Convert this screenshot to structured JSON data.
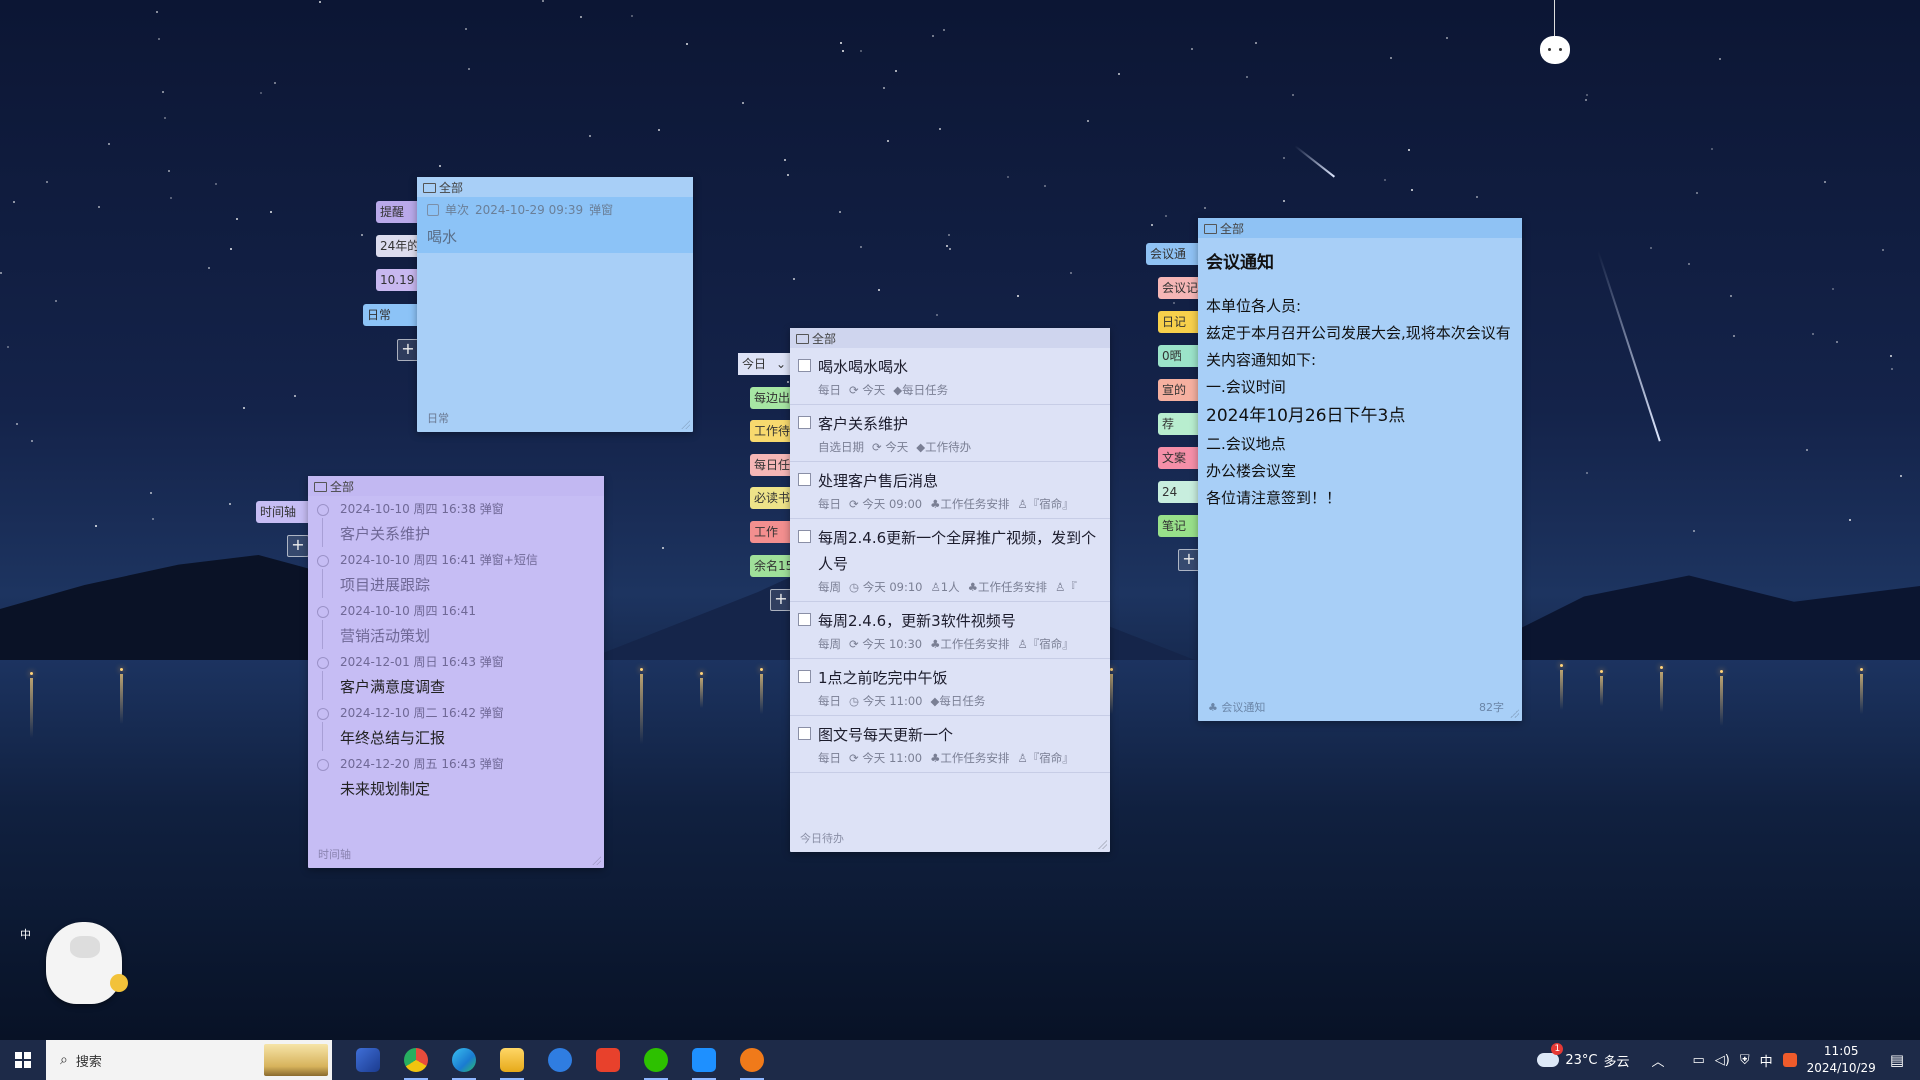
{
  "desktop": {
    "ime_mode": "中"
  },
  "note_daily": {
    "folder": "全部",
    "side_tabs": [
      "提醒",
      "24年的",
      "10.19",
      "日常"
    ],
    "item": {
      "repeat": "单次",
      "datetime": "2024-10-29 09:39",
      "mode": "弹窗",
      "title": "喝水"
    },
    "footer": "日常"
  },
  "note_timeline": {
    "folder": "全部",
    "side_tabs": [
      "时间轴"
    ],
    "items": [
      {
        "date": "2024-10-10 周四 16:38  弹窗",
        "title": "客户关系维护",
        "done": true
      },
      {
        "date": "2024-10-10 周四 16:41  弹窗+短信",
        "title": "项目进展跟踪",
        "done": true
      },
      {
        "date": "2024-10-10 周四 16:41",
        "title": "营销活动策划",
        "done": true
      },
      {
        "date": "2024-12-01 周日 16:43  弹窗",
        "title": "客户满意度调查",
        "done": false
      },
      {
        "date": "2024-12-10 周二 16:42  弹窗",
        "title": "年终总结与汇报",
        "done": false
      },
      {
        "date": "2024-12-20 周五 16:43  弹窗",
        "title": "未来规划制定",
        "done": false
      }
    ],
    "footer": "时间轴"
  },
  "note_todo": {
    "folder": "全部",
    "filter": "今日",
    "side_tabs": [
      "每边出",
      "工作待",
      "每日任",
      "必读书",
      "工作",
      "余名15"
    ],
    "items": [
      {
        "title": "喝水喝水喝水",
        "meta": [
          "每日",
          "⟳ 今天",
          "◆每日任务"
        ]
      },
      {
        "title": "客户关系维护",
        "meta": [
          "自选日期",
          "⟳ 今天",
          "◆工作待办"
        ]
      },
      {
        "title": "处理客户售后消息",
        "meta": [
          "每日",
          "⟳ 今天 09:00",
          "♣工作任务安排",
          "♙『宿命』"
        ]
      },
      {
        "title": "每周2.4.6更新一个全屏推广视频，发到个人号",
        "meta": [
          "每周",
          "◷ 今天 09:10",
          "♙1人",
          "♣工作任务安排",
          "♙『"
        ]
      },
      {
        "title": "每周2.4.6，更新3软件视频号",
        "meta": [
          "每周",
          "⟳ 今天 10:30",
          "♣工作任务安排",
          "♙『宿命』"
        ]
      },
      {
        "title": "1点之前吃完中午饭",
        "meta": [
          "每日",
          "◷ 今天 11:00",
          "◆每日任务"
        ]
      },
      {
        "title": "图文号每天更新一个",
        "meta": [
          "每日",
          "⟳ 今天 11:00",
          "♣工作任务安排",
          "♙『宿命』"
        ]
      }
    ],
    "footer": "今日待办"
  },
  "note_meeting": {
    "folder": "全部",
    "side_tabs": [
      "会议通",
      "会议记",
      "日记",
      "0晒",
      "宣的",
      "荐",
      "文案",
      "24",
      "笔记"
    ],
    "title": "会议通知",
    "lines": [
      "本单位各人员:",
      "兹定于本月召开公司发展大会,现将本次会议有关内容通知如下:",
      "一.会议时间",
      "2024年10月26日下午3点",
      "二.会议地点",
      "办公楼会议室",
      "各位请注意签到！！"
    ],
    "footer_tag": "会议通知",
    "char_count": "82字"
  },
  "taskbar": {
    "search_placeholder": "搜索",
    "apps": [
      "app-1-icon",
      "chrome-icon",
      "edge-icon",
      "file-explorer-icon",
      "app-5-icon",
      "wps-icon",
      "wechat-icon",
      "app-8-icon",
      "app-9-icon"
    ],
    "weather": {
      "temp": "23°C",
      "condition": "多云",
      "alert_badge": "1"
    },
    "ime": "中",
    "time": "11:05",
    "date": "2024/10/29"
  }
}
